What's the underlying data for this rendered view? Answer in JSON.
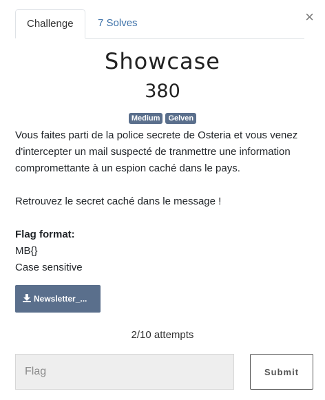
{
  "modal": {
    "close_label": "×"
  },
  "tabs": [
    {
      "label": "Challenge"
    },
    {
      "label": "7 Solves"
    }
  ],
  "challenge": {
    "name": "Showcase",
    "points": "380",
    "tags": [
      "Medium",
      "Gelven"
    ],
    "description": {
      "paragraph1": "Vous faites parti de la police secrete de Osteria et vous venez d'intercepter un mail suspecté de tranmettre une information compromettante à un espion caché dans le pays.",
      "paragraph2": "Retrouvez le secret caché dans le message !",
      "flag_format_label": "Flag format:",
      "flag_format_value": "MB{}",
      "case_note": "Case sensitive"
    },
    "file": {
      "label": "Newsletter_...",
      "icon": "download-icon"
    },
    "attempts": "2/10 attempts"
  },
  "form": {
    "flag_placeholder": "Flag",
    "flag_value": "",
    "submit_label": "Submit"
  }
}
